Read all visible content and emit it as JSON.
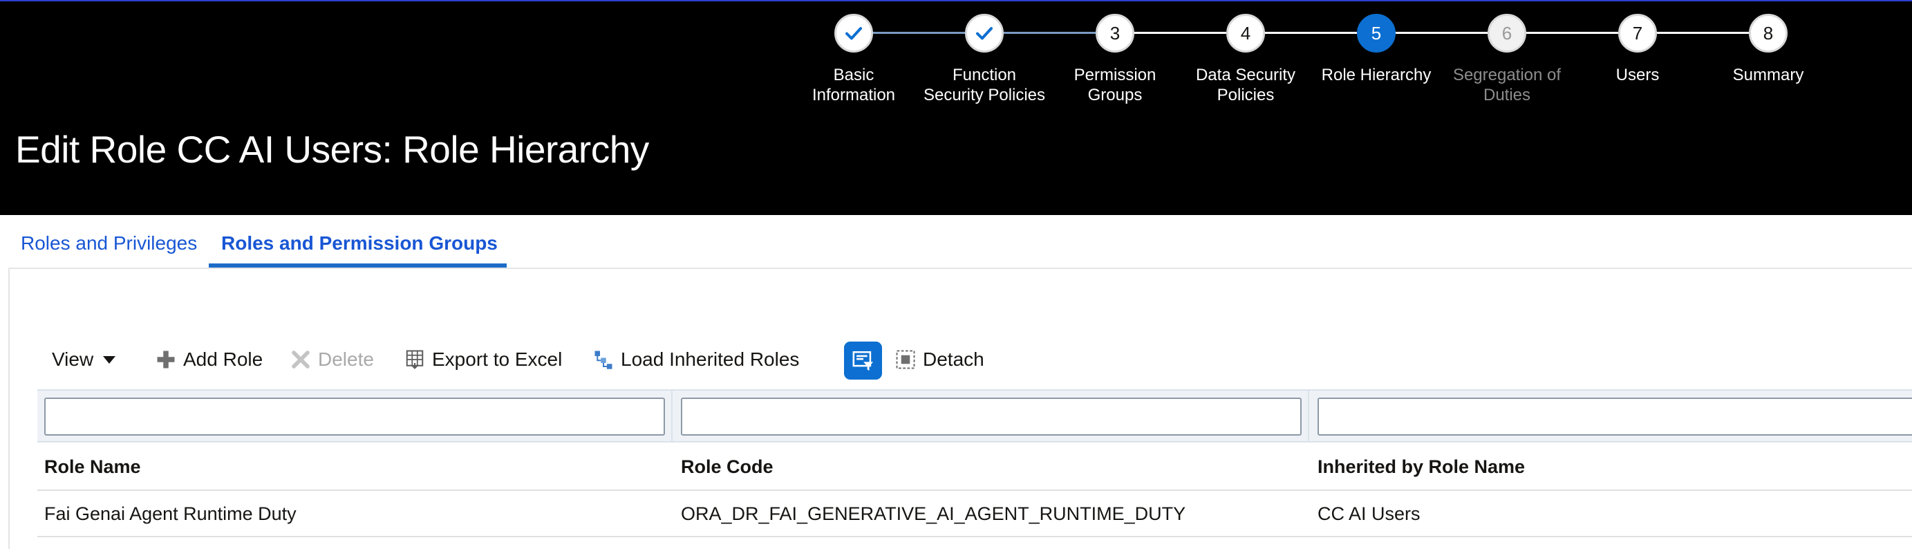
{
  "train": {
    "stops": [
      {
        "label": "Basic Information",
        "number": "",
        "state": "done"
      },
      {
        "label": "Function Security Policies",
        "number": "",
        "state": "done"
      },
      {
        "label": "Permission Groups",
        "number": "3",
        "state": "todo"
      },
      {
        "label": "Data Security Policies",
        "number": "4",
        "state": "todo"
      },
      {
        "label": "Role Hierarchy",
        "number": "5",
        "state": "current"
      },
      {
        "label": "Segregation of Duties",
        "number": "6",
        "state": "disabled"
      },
      {
        "label": "Users",
        "number": "7",
        "state": "todo"
      },
      {
        "label": "Summary",
        "number": "8",
        "state": "todo"
      }
    ],
    "labels": {
      "s1a": "Basic",
      "s1b": "Information",
      "s2a": "Function",
      "s2b": "Security Policies",
      "s3a": "Permission",
      "s3b": "Groups",
      "s4a": "Data Security",
      "s4b": "Policies",
      "s5a": "Role Hierarchy",
      "s6a": "Segregation of",
      "s6b": "Duties",
      "s7a": "Users",
      "s8a": "Summary"
    },
    "numbers": {
      "s3": "3",
      "s4": "4",
      "s5": "5",
      "s6": "6",
      "s7": "7",
      "s8": "8"
    }
  },
  "page_title": "Edit Role CC AI Users: Role Hierarchy",
  "tabs": {
    "roles_privileges": "Roles and Privileges",
    "roles_permission_groups": "Roles and Permission Groups"
  },
  "toolbar": {
    "view": "View",
    "add_role": "Add Role",
    "delete": "Delete",
    "export": "Export to Excel",
    "load_inherited": "Load Inherited Roles",
    "detach": "Detach"
  },
  "filters": {
    "role_name": "",
    "role_code": "",
    "inherited_by": ""
  },
  "table": {
    "columns": {
      "role_name": "Role Name",
      "role_code": "Role Code",
      "inherited_by": "Inherited by Role Name"
    },
    "rows": [
      {
        "role_name": "Fai Genai Agent Runtime Duty",
        "role_code": "ORA_DR_FAI_GENERATIVE_AI_AGENT_RUNTIME_DUTY",
        "inherited_by": "CC AI Users"
      }
    ]
  },
  "colors": {
    "accent": "#0c6fd1",
    "link": "#1856d4",
    "header_bg": "#000000"
  }
}
